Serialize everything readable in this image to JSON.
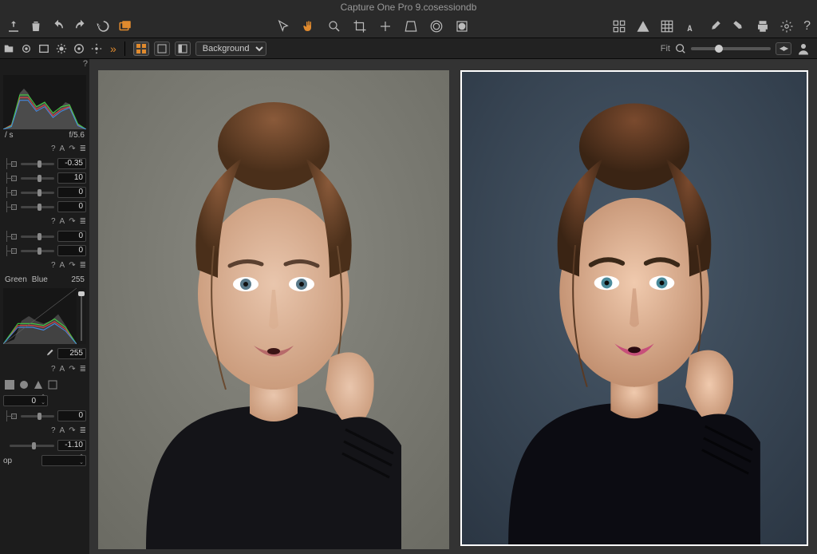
{
  "title": "Capture One Pro 9.cosessiondb",
  "breadcrumb": {
    "label": "Background"
  },
  "zoom": {
    "label": "Fit"
  },
  "exposure": {
    "iso_label": "/ s",
    "aperture": "f/5.6"
  },
  "section_icons": {
    "help": "?",
    "text": "A",
    "redo": "↷",
    "menu": "≣"
  },
  "panel1": {
    "rows": [
      {
        "value": "-0.35"
      },
      {
        "value": "10"
      },
      {
        "value": "0"
      },
      {
        "value": "0"
      }
    ]
  },
  "panel2": {
    "rows": [
      {
        "value": "0"
      },
      {
        "value": "0"
      }
    ]
  },
  "curves": {
    "channels": {
      "green": "Green",
      "blue": "Blue"
    },
    "white_point": "255",
    "picker_value": "255"
  },
  "panel3": {
    "spin": "0",
    "slider_value": "0"
  },
  "panel4": {
    "slider_value": "-1.10",
    "crop_label": "op"
  }
}
